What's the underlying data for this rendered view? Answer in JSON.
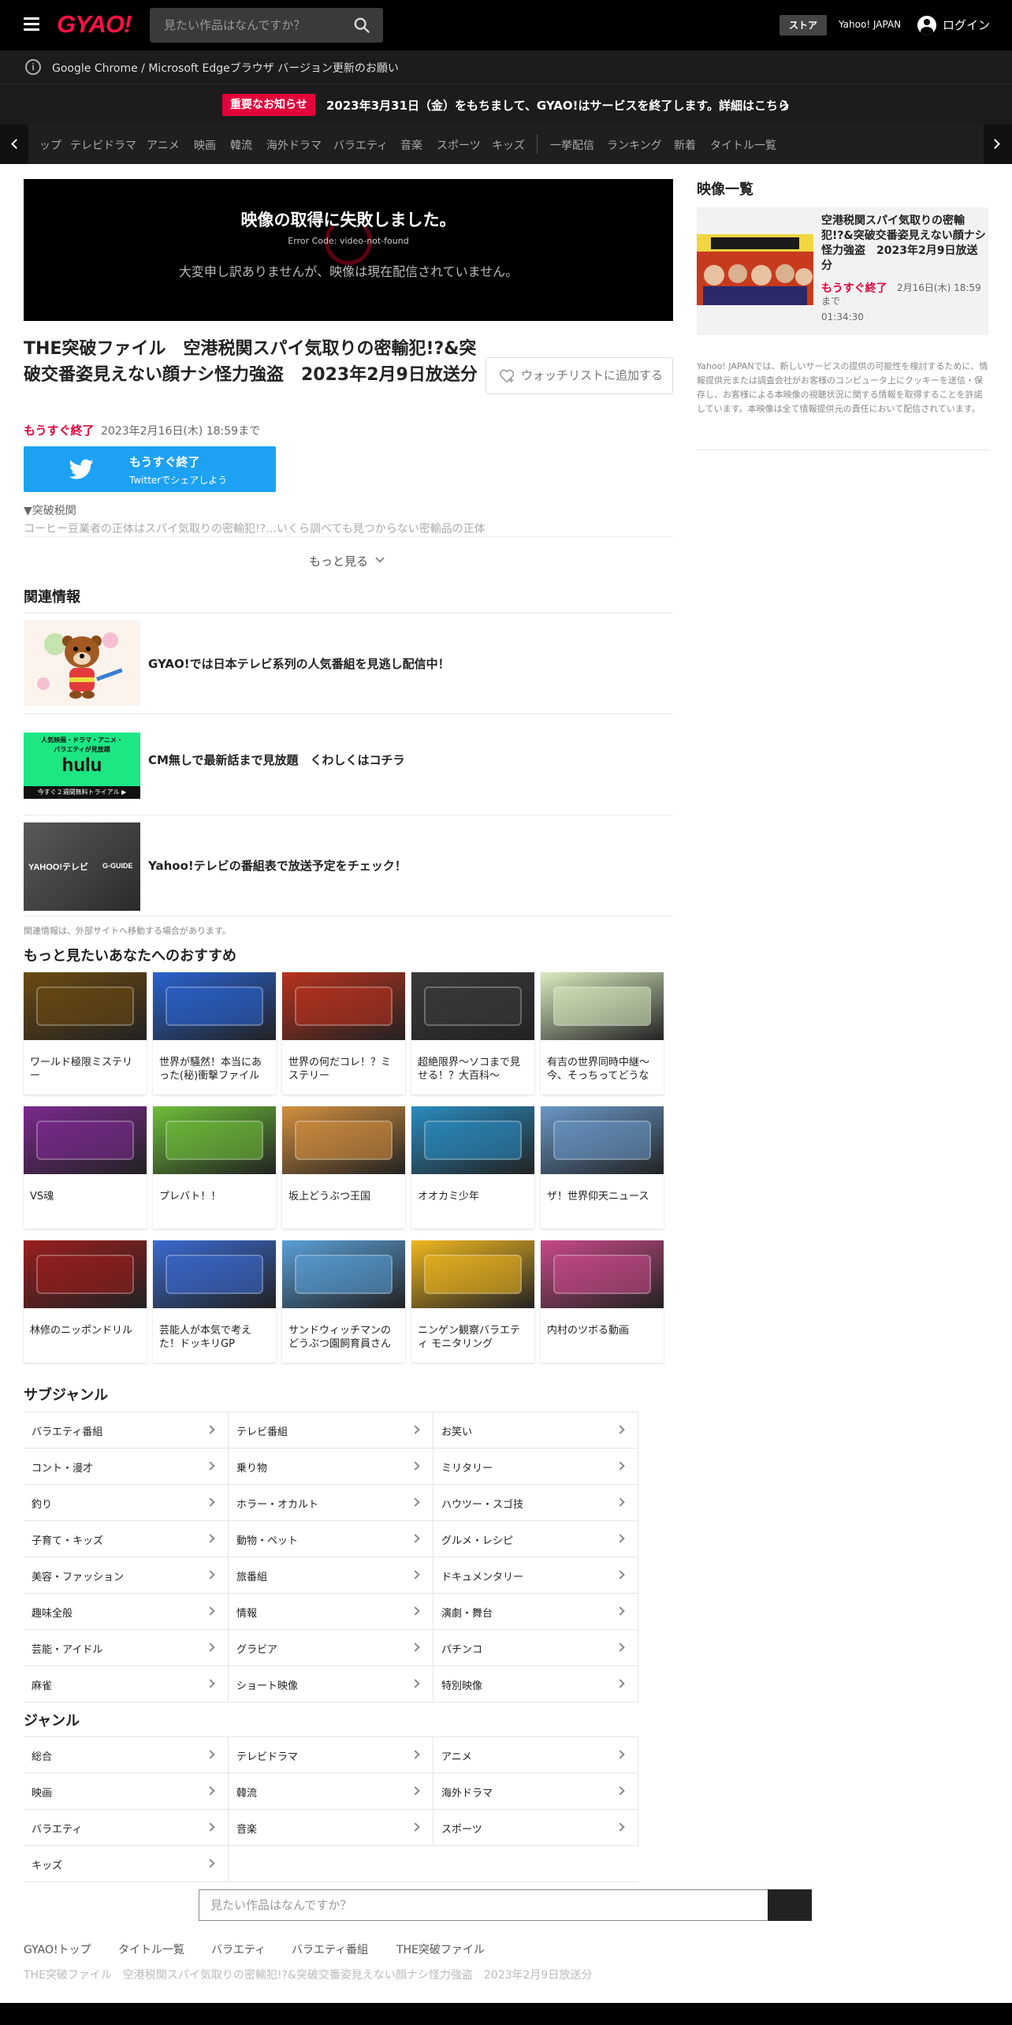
{
  "header": {
    "logo": "GYAO!",
    "search_placeholder": "見たい作品はなんですか？",
    "store": "ストア",
    "yahoo_japan": "Yahoo! JAPAN",
    "login": "ログイン"
  },
  "browser_notice": "Google Chrome / Microsoft Edgeブラウザ バージョン更新のお願い",
  "important": {
    "badge": "重要なお知らせ",
    "text": "2023年3月31日（金）をもちまして、GYAO!はサービスを終了します。詳細はこちら"
  },
  "nav": {
    "items": [
      "ップ",
      "テレビドラマ",
      "アニメ",
      "映画",
      "韓流",
      "海外ドラマ",
      "バラエティ",
      "音楽",
      "スポーツ",
      "キッズ",
      "一挙配信",
      "ランキング",
      "新着",
      "タイトル一覧"
    ]
  },
  "player": {
    "error_title": "映像の取得に失敗しました。",
    "error_code": "Error Code: video-not-found",
    "error_message": "大変申し訳ありませんが、映像は現在配信されていません。"
  },
  "video": {
    "title": "THE突破ファイル　空港税関スパイ気取りの密輸犯!?&突破交番姿見えない顔ナシ怪力強盗　2023年2月9日放送分",
    "watchlist": "ウォッチリストに追加する",
    "ending_soon": "もうすぐ終了",
    "until": "2023年2月16日(木) 18:59まで",
    "twitter_line1": "もうすぐ終了",
    "twitter_line2": "Twitterでシェアしよう",
    "section_label": "▼突破税関",
    "description": "コーヒー豆業者の正体はスパイ気取りの密輸犯!?…いくら調べても見つからない密輸品の正体",
    "more": "もっと見る"
  },
  "related": {
    "heading": "関連情報",
    "items": [
      {
        "text": "GYAO!では日本テレビ系列の人気番組を見逃し配信中！"
      },
      {
        "text": "CM無しで最新話まで見放題　くわしくはコチラ",
        "thumb_lines": [
          "人気映画・ドラマ・アニメ・",
          "バラエティが見放題",
          "hulu",
          "今すぐ２週間無料トライアル ▶"
        ]
      },
      {
        "text": "Yahoo!テレビの番組表で放送予定をチェック！",
        "thumb_lines": [
          "YAHOO!テレビ",
          "G-GUIDE"
        ]
      }
    ],
    "note": "関連情報は、外部サイトへ移動する場合があります。"
  },
  "recommend": {
    "heading": "もっと見たいあなたへのおすすめ",
    "cards": [
      {
        "title": "ワールド極限ミステリー",
        "color": "#6b4a12"
      },
      {
        "title": "世界が騒然！本当にあった(秘)衝撃ファイル",
        "color": "#2a63d0"
      },
      {
        "title": "世界の何だコレ！？ミステリー",
        "color": "#b8321e"
      },
      {
        "title": "超絶限界～ソコまで見せる！？大百科～",
        "color": "#3a3a3a"
      },
      {
        "title": "有吉の世界同時中継～今、そっちってどうな",
        "color": "#d9ecc0"
      },
      {
        "title": "VS魂",
        "color": "#7b2a8e"
      },
      {
        "title": "プレバト！！",
        "color": "#6fbf3a"
      },
      {
        "title": "坂上どうぶつ王国",
        "color": "#d49040"
      },
      {
        "title": "オオカミ少年",
        "color": "#2a8cc0"
      },
      {
        "title": "ザ！世界仰天ニュース",
        "color": "#6a98c8"
      },
      {
        "title": "林修のニッポンドリル",
        "color": "#9a1e1e"
      },
      {
        "title": "芸能人が本気で考えた！ドッキリGP",
        "color": "#3a6ad0"
      },
      {
        "title": "サンドウィッチマンのどうぶつ園飼育員さん",
        "color": "#5aa0d8"
      },
      {
        "title": "ニンゲン観察バラエティ モニタリング",
        "color": "#f0b820"
      },
      {
        "title": "内村のツボる動画",
        "color": "#c84a88"
      }
    ]
  },
  "subgenre": {
    "heading": "サブジャンル",
    "items": [
      "バラエティ番組",
      "テレビ番組",
      "お笑い",
      "コント・漫才",
      "乗り物",
      "ミリタリー",
      "釣り",
      "ホラー・オカルト",
      "ハウツー・スゴ技",
      "子育て・キッズ",
      "動物・ペット",
      "グルメ・レシピ",
      "美容・ファッション",
      "旅番組",
      "ドキュメンタリー",
      "趣味全般",
      "情報",
      "演劇・舞台",
      "芸能・アイドル",
      "グラビア",
      "パチンコ",
      "麻雀",
      "ショート映像",
      "特別映像"
    ]
  },
  "genre": {
    "heading": "ジャンル",
    "items": [
      "総合",
      "テレビドラマ",
      "アニメ",
      "映画",
      "韓流",
      "海外ドラマ",
      "バラエティ",
      "音楽",
      "スポーツ",
      "キッズ"
    ]
  },
  "footer": {
    "search_placeholder": "見たい作品はなんですか？",
    "breadcrumbs": [
      "GYAO!トップ",
      "タイトル一覧",
      "バラエティ",
      "バラエティ番組",
      "THE突破ファイル"
    ],
    "current": "THE突破ファイル　空港税関スパイ気取りの密輸犯!?&突破交番姿見えない顔ナシ怪力強盗　2023年2月9日放送分"
  },
  "sidebar": {
    "heading": "映像一覧",
    "item": {
      "title": "空港税関スパイ気取りの密輸犯!?&突破交番姿見えない顔ナシ怪力強盗　2023年2月9日放送分",
      "ending_soon": "もうすぐ終了",
      "date": "2月16日(木) 18:59",
      "made": "まで",
      "duration": "01:34:30"
    },
    "disclaimer": "Yahoo! JAPANでは、新しいサービスの提供の可能性を検討するために、情報提供元または調査会社がお客様のコンピュータ上にクッキーを送信・保存し、お客様による本映像の視聴状況に関する情報を取得することを許諾しています。本映像は全て情報提供元の責任において配信されています。"
  },
  "colors": {
    "accent": "#e3003a",
    "logo": "#ff1144",
    "twitter": "#1da1f2"
  }
}
